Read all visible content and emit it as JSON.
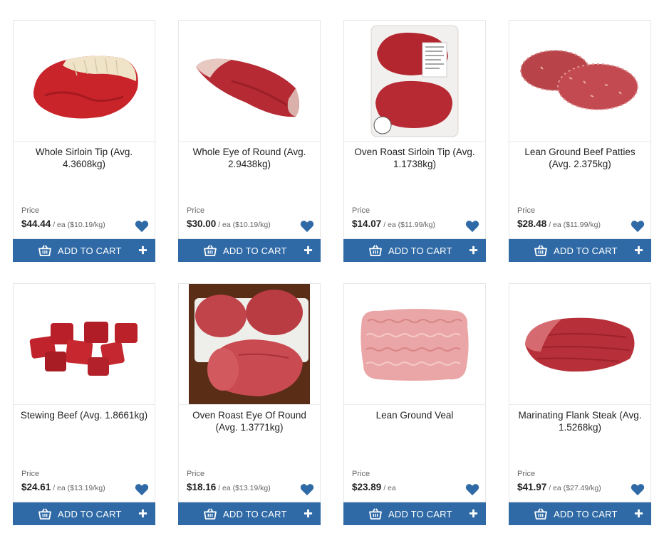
{
  "colors": {
    "accent": "#2f6aa6",
    "heart": "#2f6aa6",
    "border": "#e6e6e6"
  },
  "products": [
    {
      "title": "Whole Sirloin Tip (Avg. 4.3608kg)",
      "price_label": "Price",
      "price": "$44.44",
      "unit": " / ea ($10.19/kg)",
      "button": "ADD TO CART",
      "image": "whole-sirloin-tip-image"
    },
    {
      "title": "Whole Eye of Round (Avg. 2.9438kg)",
      "price_label": "Price",
      "price": "$30.00",
      "unit": " / ea ($10.19/kg)",
      "button": "ADD TO CART",
      "image": "whole-eye-of-round-image"
    },
    {
      "title": "Oven Roast Sirloin Tip (Avg. 1.1738kg)",
      "price_label": "Price",
      "price": "$14.07",
      "unit": " / ea ($11.99/kg)",
      "button": "ADD TO CART",
      "image": "oven-roast-sirloin-tip-image"
    },
    {
      "title": "Lean Ground Beef Patties (Avg. 2.375kg)",
      "price_label": "Price",
      "price": "$28.48",
      "unit": " / ea ($11.99/kg)",
      "button": "ADD TO CART",
      "image": "ground-beef-patties-image"
    },
    {
      "title": "Stewing Beef (Avg. 1.8661kg)",
      "price_label": "Price",
      "price": "$24.61",
      "unit": " / ea ($13.19/kg)",
      "button": "ADD TO CART",
      "image": "stewing-beef-image"
    },
    {
      "title": "Oven Roast Eye Of Round (Avg. 1.3771kg)",
      "price_label": "Price",
      "price": "$18.16",
      "unit": " / ea ($13.19/kg)",
      "button": "ADD TO CART",
      "image": "oven-roast-eye-of-round-image"
    },
    {
      "title": "Lean Ground Veal",
      "price_label": "Price",
      "price": "$23.89",
      "unit": " / ea",
      "button": "ADD TO CART",
      "image": "lean-ground-veal-image"
    },
    {
      "title": "Marinating Flank Steak (Avg. 1.5268kg)",
      "price_label": "Price",
      "price": "$41.97",
      "unit": " / ea ($27.49/kg)",
      "button": "ADD TO CART",
      "image": "flank-steak-image"
    }
  ]
}
